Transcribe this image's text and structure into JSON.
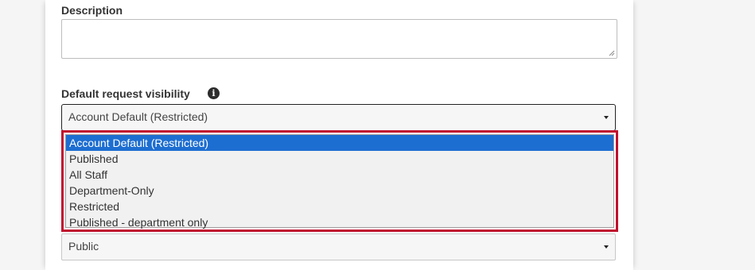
{
  "description_field": {
    "label": "Description",
    "value": ""
  },
  "visibility": {
    "label": "Default request visibility",
    "info_icon": "info-icon",
    "selected_value": "Account Default (Restricted)",
    "options": [
      "Account Default (Restricted)",
      "Published",
      "All Staff",
      "Department-Only",
      "Restricted",
      "Published - department only"
    ]
  },
  "next_select": {
    "selected_value": "Public"
  },
  "colors": {
    "highlight_border": "#c0102e",
    "selected_option_bg": "#1d6ed1"
  }
}
